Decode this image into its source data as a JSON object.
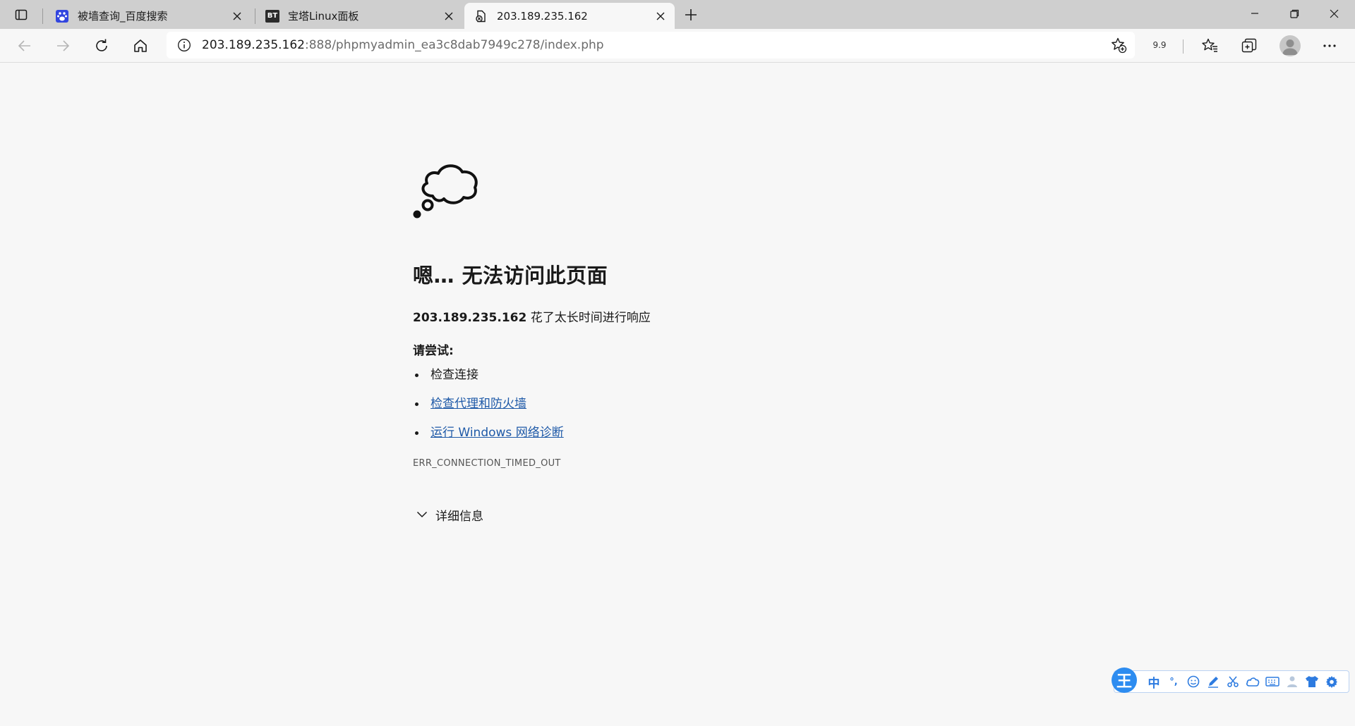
{
  "browser": {
    "tabs": [
      {
        "title": "被墙查询_百度搜索",
        "favicon": "baidu-paw-icon",
        "active": false
      },
      {
        "title": "宝塔Linux面板",
        "favicon": "bt-icon",
        "favicon_text": "BT",
        "active": false
      },
      {
        "title": "203.189.235.162",
        "favicon": "page-error-icon",
        "active": true
      }
    ],
    "address": {
      "host": "203.189.235.162",
      "path": ":888/phpmyadmin_ea3c8dab7949c278/index.php"
    },
    "readout": "9.9"
  },
  "error": {
    "title": "嗯… 无法访问此页面",
    "host": "203.189.235.162",
    "description": " 花了太长时间进行响应",
    "try_label": "请尝试:",
    "suggestions": [
      {
        "label": "检查连接",
        "link": false
      },
      {
        "label": "检查代理和防火墙",
        "link": true
      },
      {
        "label": "运行 Windows 网络诊断",
        "link": true
      }
    ],
    "code": "ERR_CONNECTION_TIMED_OUT",
    "details_label": "详细信息"
  },
  "ime": {
    "logo": "王",
    "items": [
      "中",
      "°,",
      "emoji-icon",
      "pen-icon",
      "scissors-icon",
      "cloud-icon",
      "keyboard-icon",
      "user-icon",
      "shirt-icon",
      "gear-icon"
    ]
  },
  "colors": {
    "link": "#1f5aa8",
    "ime_accent": "#2d8cf0"
  }
}
